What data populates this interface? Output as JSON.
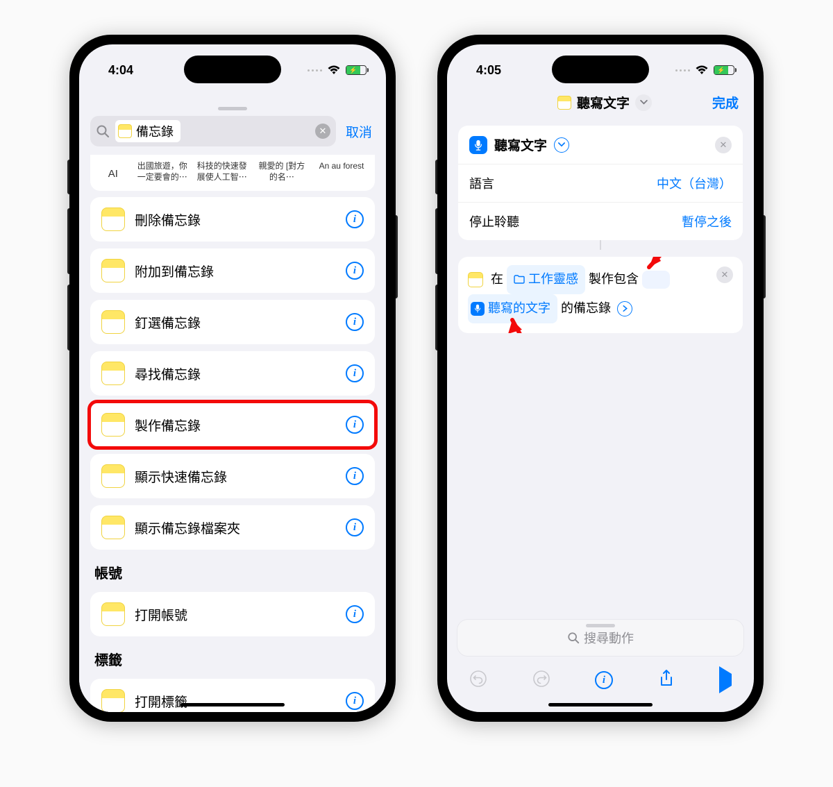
{
  "left": {
    "time": "4:04",
    "search_query": "備忘錄",
    "cancel": "取消",
    "suggestions": [
      "AI",
      "出國旅遊，你一定要會的⋯",
      "科技的快速發展使人工智⋯",
      "親愛的 [對方的名⋯",
      "An au forest"
    ],
    "actions": [
      "刪除備忘錄",
      "附加到備忘錄",
      "釘選備忘錄",
      "尋找備忘錄",
      "製作備忘錄",
      "顯示快速備忘錄",
      "顯示備忘錄檔案夾"
    ],
    "highlight_index": 4,
    "section_accounts": "帳號",
    "accounts_item": "打開帳號",
    "section_tags": "標籤",
    "tags_item": "打開標籤"
  },
  "right": {
    "time": "4:05",
    "title": "聽寫文字",
    "done": "完成",
    "card1_title": "聽寫文字",
    "row_lang_label": "語言",
    "row_lang_value": "中文（台灣）",
    "row_stop_label": "停止聆聽",
    "row_stop_value": "暫停之後",
    "card2_prefix": "在",
    "card2_folder": "工作靈感",
    "card2_mid": "製作包含",
    "card2_var": "聽寫的文字",
    "card2_suffix": "的備忘錄",
    "search_actions": "搜尋動作"
  }
}
